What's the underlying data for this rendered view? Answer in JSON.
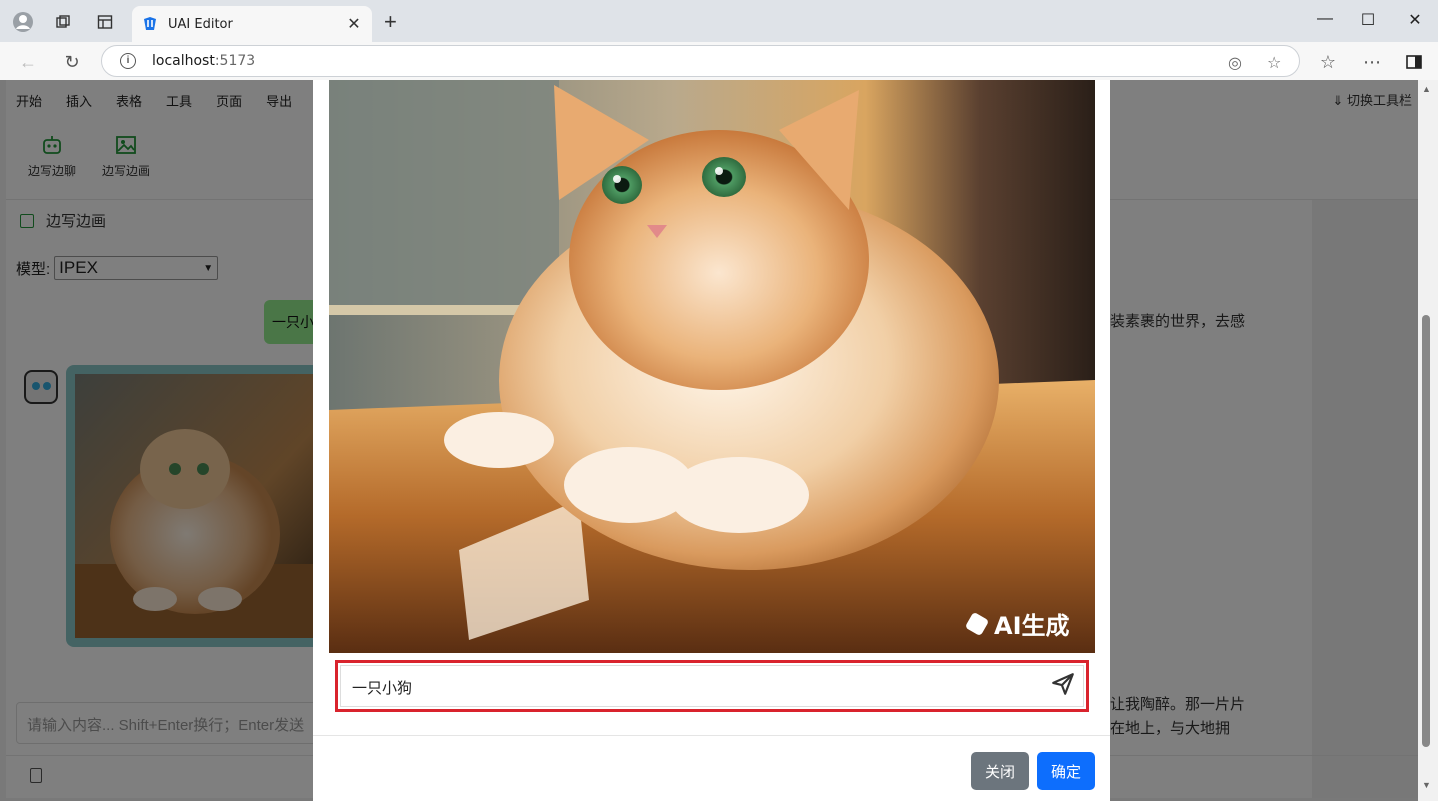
{
  "browser": {
    "tab_title": "UAI Editor",
    "url_host": "localhost",
    "url_port": ":5173"
  },
  "menu": {
    "items": [
      "开始",
      "插入",
      "表格",
      "工具",
      "页面",
      "导出"
    ],
    "switch_toolbar": "切换工具栏"
  },
  "toolbar": {
    "chat_label": "边写边聊",
    "draw_label": "边写边画"
  },
  "ai_panel": {
    "title": "边写边画",
    "model_label": "模型:",
    "model_value": "IPEX",
    "user_message": "一只小狗",
    "input_placeholder": "请输入内容... Shift+Enter换行；Enter发送"
  },
  "document": {
    "line1": "装素裹的世界，去感",
    "line2": "让我陶醉。那一片片",
    "line3": "在地上，与大地拥"
  },
  "modal": {
    "watermark": "AI生成",
    "prompt_value": "一只小狗",
    "close_label": "关闭",
    "ok_label": "确定"
  }
}
